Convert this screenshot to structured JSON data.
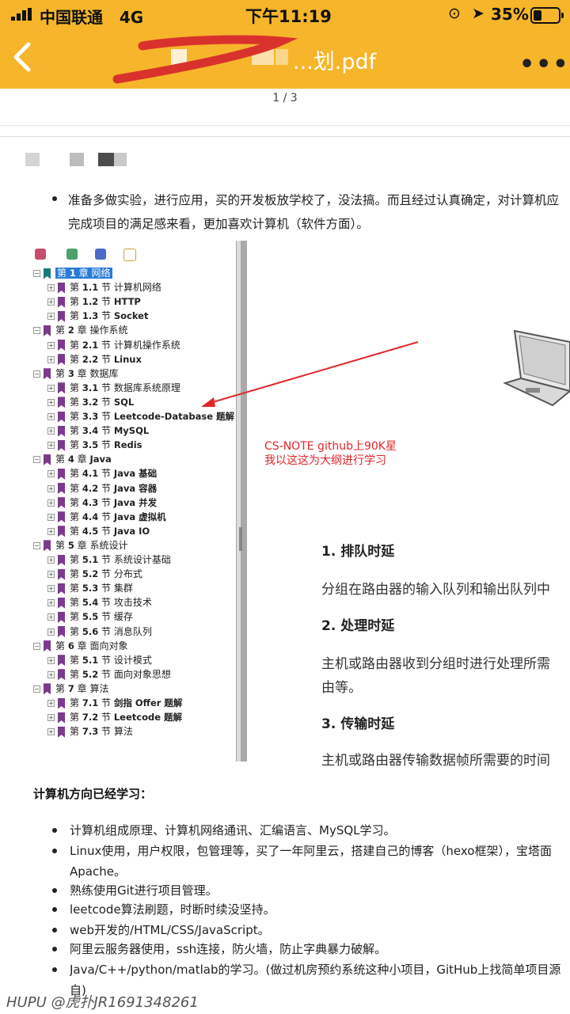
{
  "status_bar": {
    "carrier": "中国联通",
    "network": "4G",
    "time": "下午11:19",
    "battery": "35%"
  },
  "header": {
    "title_visible": "...划.pdf",
    "more": "•••"
  },
  "page_indicator": "1 / 3",
  "intro_bullet": {
    "line1": "准备多做实验，进行应用，买的开发板放学校了，没法搞。而且经过认真确定，对计算机应",
    "line2": "完成项目的满足感来看，更加喜欢计算机（软件方面）。"
  },
  "tree": [
    {
      "level": 0,
      "pre": "第",
      "num": "1",
      "mid": "章",
      "name": "网络",
      "selected": true
    },
    {
      "level": 1,
      "pre": "第",
      "num": "1.1",
      "mid": "节",
      "name": "计算机网络"
    },
    {
      "level": 1,
      "pre": "第",
      "num": "1.2",
      "mid": "节",
      "name": "HTTP",
      "bold": true
    },
    {
      "level": 1,
      "pre": "第",
      "num": "1.3",
      "mid": "节",
      "name": "Socket",
      "bold": true
    },
    {
      "level": 0,
      "pre": "第",
      "num": "2",
      "mid": "章",
      "name": "操作系统"
    },
    {
      "level": 1,
      "pre": "第",
      "num": "2.1",
      "mid": "节",
      "name": "计算机操作系统"
    },
    {
      "level": 1,
      "pre": "第",
      "num": "2.2",
      "mid": "节",
      "name": "Linux",
      "bold": true
    },
    {
      "level": 0,
      "pre": "第",
      "num": "3",
      "mid": "章",
      "name": "数据库"
    },
    {
      "level": 1,
      "pre": "第",
      "num": "3.1",
      "mid": "节",
      "name": "数据库系统原理"
    },
    {
      "level": 1,
      "pre": "第",
      "num": "3.2",
      "mid": "节",
      "name": "SQL",
      "bold": true
    },
    {
      "level": 1,
      "pre": "第",
      "num": "3.3",
      "mid": "节",
      "name": "Leetcode-Database 题解",
      "bold": true
    },
    {
      "level": 1,
      "pre": "第",
      "num": "3.4",
      "mid": "节",
      "name": "MySQL",
      "bold": true
    },
    {
      "level": 1,
      "pre": "第",
      "num": "3.5",
      "mid": "节",
      "name": "Redis",
      "bold": true
    },
    {
      "level": 0,
      "pre": "第",
      "num": "4",
      "mid": "章",
      "name": "Java",
      "bold": true
    },
    {
      "level": 1,
      "pre": "第",
      "num": "4.1",
      "mid": "节",
      "name": "Java 基础",
      "bold": true
    },
    {
      "level": 1,
      "pre": "第",
      "num": "4.2",
      "mid": "节",
      "name": "Java 容器",
      "bold": true
    },
    {
      "level": 1,
      "pre": "第",
      "num": "4.3",
      "mid": "节",
      "name": "Java 并发",
      "bold": true
    },
    {
      "level": 1,
      "pre": "第",
      "num": "4.4",
      "mid": "节",
      "name": "Java 虚拟机",
      "bold": true
    },
    {
      "level": 1,
      "pre": "第",
      "num": "4.5",
      "mid": "节",
      "name": "Java IO",
      "bold": true
    },
    {
      "level": 0,
      "pre": "第",
      "num": "5",
      "mid": "章",
      "name": "系统设计"
    },
    {
      "level": 1,
      "pre": "第",
      "num": "5.1",
      "mid": "节",
      "name": "系统设计基础"
    },
    {
      "level": 1,
      "pre": "第",
      "num": "5.2",
      "mid": "节",
      "name": "分布式"
    },
    {
      "level": 1,
      "pre": "第",
      "num": "5.3",
      "mid": "节",
      "name": "集群"
    },
    {
      "level": 1,
      "pre": "第",
      "num": "5.4",
      "mid": "节",
      "name": "攻击技术"
    },
    {
      "level": 1,
      "pre": "第",
      "num": "5.5",
      "mid": "节",
      "name": "缓存"
    },
    {
      "level": 1,
      "pre": "第",
      "num": "5.6",
      "mid": "节",
      "name": "消息队列"
    },
    {
      "level": 0,
      "pre": "第",
      "num": "6",
      "mid": "章",
      "name": "面向对象"
    },
    {
      "level": 1,
      "pre": "第",
      "num": "5.1",
      "mid": "节",
      "name": "设计模式"
    },
    {
      "level": 1,
      "pre": "第",
      "num": "5.2",
      "mid": "节",
      "name": "面向对象思想"
    },
    {
      "level": 0,
      "pre": "第",
      "num": "7",
      "mid": "章",
      "name": "算法"
    },
    {
      "level": 1,
      "pre": "第",
      "num": "7.1",
      "mid": "节",
      "name": "剑指 Offer 题解",
      "bold": true
    },
    {
      "level": 1,
      "pre": "第",
      "num": "7.2",
      "mid": "节",
      "name": "Leetcode 题解",
      "bold": true
    },
    {
      "level": 1,
      "pre": "第",
      "num": "7.3",
      "mid": "节",
      "name": "算法"
    }
  ],
  "annotation": {
    "line1": "CS-NOTE github上90K星",
    "line2": "我以这这为大纲进行学习"
  },
  "right_doc": {
    "h1": "1. 排队时延",
    "p1": "分组在路由器的输入队列和输出队列中",
    "h2": "2. 处理时延",
    "p2a": "主机或路由器收到分组时进行处理所需",
    "p2b": "由等。",
    "h3": "3. 传输时延",
    "p3": "主机或路由器传输数据帧所需要的时间"
  },
  "section_heading": "计算机方向已经学习：",
  "learned": [
    "计算机组成原理、计算机网络通讯、汇编语言、MySQL学习。",
    "Linux使用，用户权限，包管理等，买了一年阿里云，搭建自己的博客（hexo框架），宝塔面",
    "Apache。",
    "熟练使用Git进行项目管理。",
    "leetcode算法刷题，时断时续没坚持。",
    "web开发的/HTML/CSS/JavaScript。",
    "阿里云服务器使用，ssh连接，防火墙，防止字典暴力破解。",
    "Java/C++/python/matlab的学习。(做过机房预约系统这种小项目，GitHub上找简单项目源",
    "自)"
  ],
  "watermark": "HUPU @虎扑JR1691348261",
  "colors": {
    "header": "#f6b52a",
    "annotation": "#e0262b",
    "bookmark": "#7b3b8c",
    "selection": "#2a7bd6"
  }
}
